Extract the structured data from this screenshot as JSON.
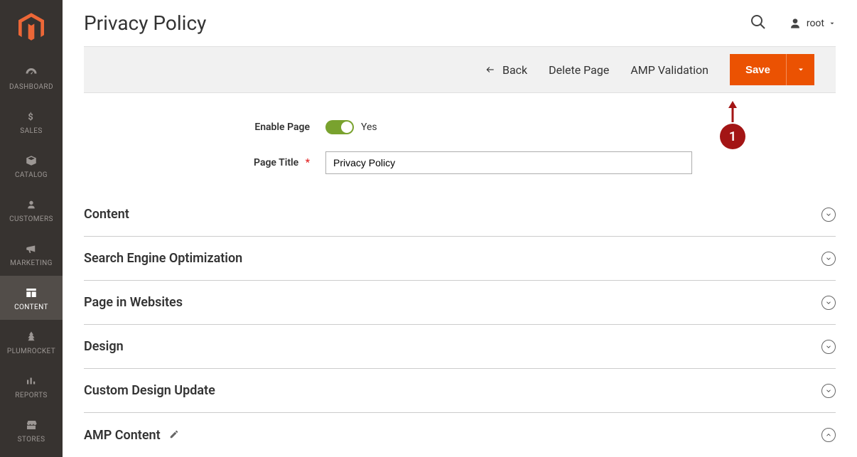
{
  "nav": {
    "items": [
      {
        "label": "DASHBOARD"
      },
      {
        "label": "SALES"
      },
      {
        "label": "CATALOG"
      },
      {
        "label": "CUSTOMERS"
      },
      {
        "label": "MARKETING"
      },
      {
        "label": "CONTENT"
      },
      {
        "label": "PLUMROCKET"
      },
      {
        "label": "REPORTS"
      },
      {
        "label": "STORES"
      }
    ],
    "active_index": 5
  },
  "header": {
    "title": "Privacy Policy",
    "user": "root"
  },
  "action_bar": {
    "back": "Back",
    "delete": "Delete Page",
    "amp_validation": "AMP Validation",
    "save": "Save"
  },
  "form": {
    "enable_label": "Enable Page",
    "enable_value_text": "Yes",
    "page_title_label": "Page Title",
    "page_title_value": "Privacy Policy"
  },
  "sections": [
    {
      "label": "Content",
      "expanded": false,
      "edit": false
    },
    {
      "label": "Search Engine Optimization",
      "expanded": false,
      "edit": false
    },
    {
      "label": "Page in Websites",
      "expanded": false,
      "edit": false
    },
    {
      "label": "Design",
      "expanded": false,
      "edit": false
    },
    {
      "label": "Custom Design Update",
      "expanded": false,
      "edit": false
    },
    {
      "label": "AMP Content",
      "expanded": true,
      "edit": true
    }
  ],
  "callout": {
    "number": "1"
  }
}
